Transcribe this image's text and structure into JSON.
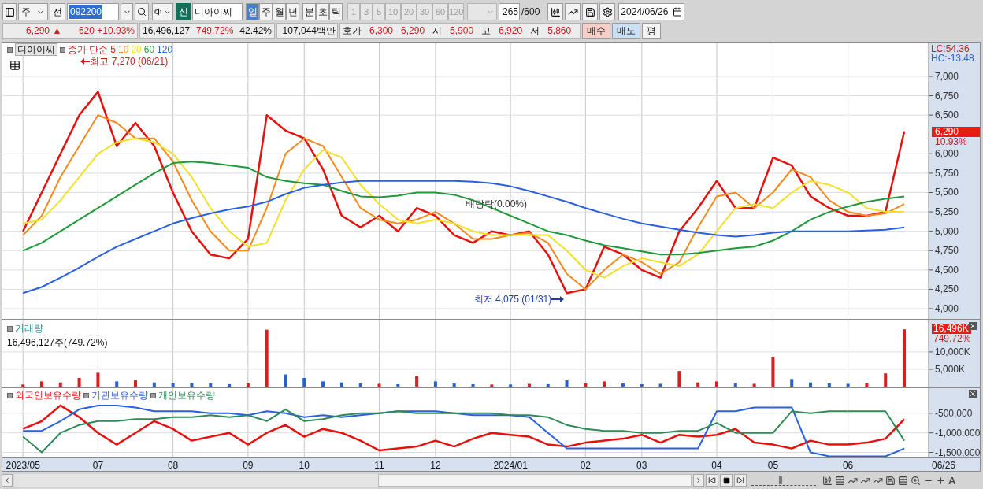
{
  "toolbar": {
    "market": "주",
    "prev_button": "전",
    "code": "092200",
    "badge": "신",
    "stock_name": "디아이씨",
    "periods": [
      {
        "label": "일",
        "selected": true
      },
      {
        "label": "주",
        "selected": false
      },
      {
        "label": "월",
        "selected": false
      },
      {
        "label": "년",
        "selected": false
      },
      {
        "label": "분",
        "selected": false
      },
      {
        "label": "초",
        "selected": false
      },
      {
        "label": "틱",
        "selected": false
      }
    ],
    "intervals": [
      {
        "label": "1",
        "disabled": true
      },
      {
        "label": "3",
        "disabled": true
      },
      {
        "label": "5",
        "disabled": true
      },
      {
        "label": "10",
        "disabled": true
      },
      {
        "label": "20",
        "disabled": true
      },
      {
        "label": "30",
        "disabled": true
      },
      {
        "label": "60",
        "disabled": true
      },
      {
        "label": "120",
        "disabled": true
      }
    ],
    "count": "265",
    "count_total": "/600",
    "date": "2024/06/26"
  },
  "quote_bar": {
    "price": "6,290",
    "arrow": "▲",
    "change": "620",
    "change_rate": "+10.93%",
    "volume": "16,496,127",
    "volume_rate": "749.72%",
    "turnover": "42.42%",
    "amount": "107,044백만",
    "ask_label": "호가",
    "ask": "6,300",
    "bid": "6,290",
    "open_label": "시",
    "open": "5,900",
    "high_label": "고",
    "high": "6,920",
    "low_label": "저",
    "low": "5,860",
    "buttons": [
      {
        "label": "매수",
        "kind": "buy"
      },
      {
        "label": "매도",
        "kind": "sell"
      },
      {
        "label": "평",
        "kind": "plain"
      }
    ]
  },
  "price_panel": {
    "stock_name": "디아이씨",
    "legend_prefix": "종가 단순",
    "high_note": "최고 7,270 (06/21)",
    "low_note": "최저 4,075 (01/31)",
    "dividend_note": "배당락(0.00%)",
    "lc": "LC:54.36",
    "hc": "HC:-13.48",
    "last_price": "6,290",
    "last_rate": "10.93%",
    "chart_data": {
      "type": "line",
      "grid": true,
      "ylim": [
        3868,
        7437
      ],
      "yticks": [
        {
          "value": 4000,
          "label": "4,000"
        },
        {
          "value": 4250,
          "label": "4,250"
        },
        {
          "value": 4500,
          "label": "4,500"
        },
        {
          "value": 4750,
          "label": "4,750"
        },
        {
          "value": 5000,
          "label": "5,000"
        },
        {
          "value": 5250,
          "label": "5,250"
        },
        {
          "value": 5500,
          "label": "5,500"
        },
        {
          "value": 5750,
          "label": "5,750"
        },
        {
          "value": 6000,
          "label": "6,000"
        },
        {
          "value": 6500,
          "label": "6,500"
        },
        {
          "value": 6750,
          "label": "6,750"
        },
        {
          "value": 7000,
          "label": "7,000"
        }
      ],
      "series": [
        {
          "name": "5",
          "color": "#e8100c",
          "values": [
            5000,
            5500,
            6000,
            6500,
            6800,
            6100,
            6400,
            6100,
            5500,
            5000,
            4700,
            4650,
            4900,
            6500,
            6300,
            6200,
            5800,
            5200,
            5050,
            5200,
            5000,
            5300,
            5200,
            4950,
            4850,
            5000,
            4950,
            5000,
            4700,
            4200,
            4250,
            4800,
            4700,
            4500,
            4400,
            5000,
            5300,
            5650,
            5300,
            5300,
            5950,
            5850,
            5450,
            5300,
            5200,
            5200,
            5250,
            6290
          ]
        },
        {
          "name": "10",
          "color": "#f28a1c",
          "values": [
            4950,
            5200,
            5700,
            6100,
            6500,
            6400,
            6200,
            6200,
            5900,
            5400,
            5000,
            4750,
            4750,
            5300,
            6000,
            6200,
            6100,
            5700,
            5300,
            5150,
            5100,
            5150,
            5250,
            5100,
            4900,
            4900,
            4950,
            4980,
            4850,
            4450,
            4250,
            4500,
            4700,
            4600,
            4450,
            4600,
            5050,
            5450,
            5500,
            5300,
            5500,
            5800,
            5700,
            5400,
            5250,
            5200,
            5230,
            5350
          ]
        },
        {
          "name": "20",
          "color": "#f2e02a",
          "values": [
            5100,
            5150,
            5400,
            5700,
            6000,
            6150,
            6200,
            6150,
            6000,
            5700,
            5300,
            5000,
            4800,
            4850,
            5400,
            5800,
            6050,
            5950,
            5600,
            5350,
            5150,
            5100,
            5150,
            5100,
            5000,
            4950,
            4950,
            4950,
            4950,
            4750,
            4500,
            4400,
            4550,
            4650,
            4600,
            4550,
            4700,
            5000,
            5300,
            5350,
            5300,
            5500,
            5650,
            5600,
            5500,
            5300,
            5250,
            5250
          ]
        },
        {
          "name": "60",
          "color": "#1e9a3a",
          "values": [
            4750,
            4850,
            5000,
            5150,
            5300,
            5450,
            5600,
            5750,
            5880,
            5900,
            5880,
            5850,
            5820,
            5700,
            5650,
            5620,
            5600,
            5520,
            5450,
            5440,
            5460,
            5500,
            5500,
            5470,
            5400,
            5300,
            5200,
            5100,
            5000,
            4950,
            4880,
            4820,
            4780,
            4740,
            4700,
            4700,
            4720,
            4750,
            4780,
            4800,
            4880,
            5000,
            5150,
            5250,
            5320,
            5380,
            5420,
            5450
          ]
        },
        {
          "name": "120",
          "color": "#2a5fe0",
          "values": [
            4200,
            4280,
            4400,
            4530,
            4670,
            4800,
            4900,
            5000,
            5100,
            5170,
            5230,
            5280,
            5320,
            5380,
            5480,
            5560,
            5600,
            5630,
            5650,
            5650,
            5650,
            5650,
            5650,
            5650,
            5640,
            5620,
            5580,
            5520,
            5450,
            5380,
            5300,
            5230,
            5160,
            5100,
            5060,
            5020,
            4980,
            4950,
            4930,
            4950,
            4980,
            5000,
            5000,
            5000,
            5000,
            5010,
            5020,
            5050
          ]
        }
      ]
    }
  },
  "volume_panel": {
    "summary": "16,496,127주(749.72%)",
    "last_value": "16,496K",
    "last_rate": "749.72%",
    "chart_data": {
      "type": "bar",
      "grid": true,
      "ylim": [
        0,
        19048
      ],
      "yticks": [
        {
          "value": 5000,
          "label": "5,000K"
        },
        {
          "value": 10000,
          "label": "10,000K"
        }
      ],
      "series": [
        {
          "name": "거래량",
          "values": [
            600,
            1500,
            1200,
            2500,
            4000,
            1500,
            1800,
            1200,
            900,
            1100,
            900,
            700,
            1000,
            16400,
            3500,
            2500,
            1500,
            1200,
            900,
            800,
            700,
            3000,
            1500,
            900,
            700,
            600,
            600,
            800,
            700,
            1800,
            900,
            1500,
            900,
            700,
            800,
            4500,
            1200,
            1500,
            900,
            800,
            8500,
            2200,
            1200,
            900,
            800,
            1000,
            3800,
            16500
          ]
        }
      ]
    }
  },
  "holdings_panel": {
    "chart_data": {
      "type": "line",
      "grid": true,
      "categories": [
        "2023/05",
        null,
        null,
        null,
        "07",
        null,
        null,
        null,
        "08",
        null,
        null,
        null,
        "09",
        null,
        null,
        "10",
        null,
        null,
        null,
        "11",
        null,
        null,
        "12",
        null,
        null,
        null,
        "2024/01",
        null,
        null,
        null,
        "02",
        null,
        null,
        "03",
        null,
        null,
        null,
        "04",
        null,
        null,
        "05",
        null,
        null,
        null,
        "06",
        null,
        null,
        null
      ],
      "ylim": [
        -1610000,
        140000
      ],
      "yticks": [
        {
          "value": -500000,
          "label": "-500,000"
        },
        {
          "value": -1000000,
          "label": "-1,000,000"
        },
        {
          "value": -1500000,
          "label": "-1,500,000"
        }
      ],
      "series": [
        {
          "name": "외국인보유수량",
          "color": "#e8100c",
          "values": [
            -900000,
            -700000,
            -300000,
            -600000,
            -1000000,
            -1300000,
            -1000000,
            -700000,
            -900000,
            -1200000,
            -1100000,
            -1000000,
            -1300000,
            -1000000,
            -800000,
            -1100000,
            -900000,
            -1000000,
            -1200000,
            -1450000,
            -1400000,
            -1350000,
            -1200000,
            -1350000,
            -1150000,
            -1000000,
            -1050000,
            -1100000,
            -1300000,
            -1350000,
            -1250000,
            -1200000,
            -1150000,
            -1050000,
            -1250000,
            -1050000,
            -1100000,
            -1050000,
            -900000,
            -1250000,
            -1300000,
            -1400000,
            -1200000,
            -1300000,
            -1300000,
            -1250000,
            -1150000,
            -650000
          ]
        },
        {
          "name": "기관보유수량",
          "color": "#2a5fe0",
          "values": [
            -950000,
            -950000,
            -700000,
            -400000,
            -300000,
            -300000,
            -350000,
            -450000,
            -450000,
            -450000,
            -500000,
            -500000,
            -550000,
            -450000,
            -500000,
            -600000,
            -550000,
            -600000,
            -550000,
            -500000,
            -450000,
            -450000,
            -450000,
            -500000,
            -550000,
            -550000,
            -550000,
            -600000,
            -1000000,
            -1400000,
            -1400000,
            -1400000,
            -1400000,
            -1400000,
            -1400000,
            -1400000,
            -1400000,
            -450000,
            -450000,
            -350000,
            -350000,
            -350000,
            -1500000,
            -1600000,
            -1600000,
            -1600000,
            -1600000,
            -1400000
          ]
        },
        {
          "name": "개인보유수량",
          "color": "#2e8b57",
          "values": [
            -1100000,
            -1500000,
            -1000000,
            -800000,
            -700000,
            -700000,
            -650000,
            -650000,
            -600000,
            -600000,
            -550000,
            -600000,
            -550000,
            -700000,
            -400000,
            -700000,
            -650000,
            -550000,
            -500000,
            -500000,
            -450000,
            -500000,
            -500000,
            -500000,
            -500000,
            -500000,
            -550000,
            -550000,
            -600000,
            -800000,
            -900000,
            -950000,
            -950000,
            -1000000,
            -1000000,
            -950000,
            -950000,
            -750000,
            -1000000,
            -1000000,
            -1000000,
            -450000,
            -500000,
            -450000,
            -450000,
            -450000,
            -450000,
            -1200000
          ]
        }
      ]
    },
    "end_date": "06/26"
  },
  "bottom_bar": {
    "font_button": "A",
    "zoom_level": {
      "level": 0.45
    }
  }
}
